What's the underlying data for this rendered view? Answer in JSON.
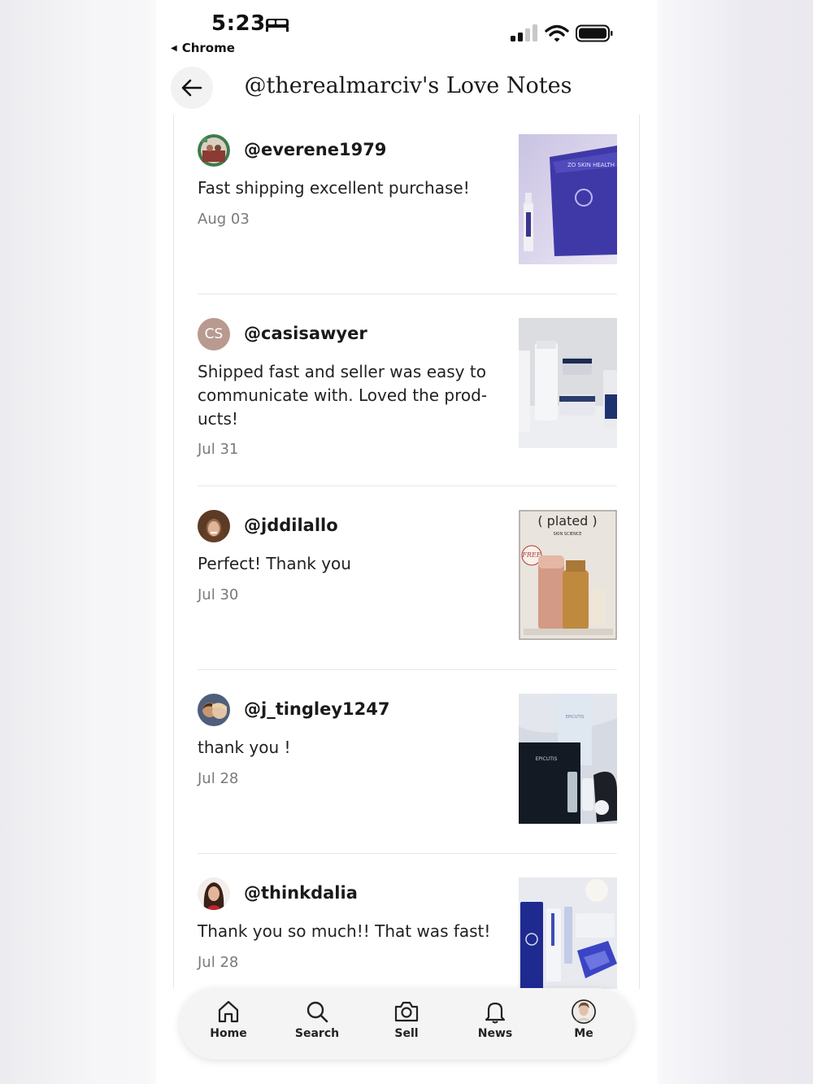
{
  "status_bar": {
    "time": "5:23",
    "back_app": "Chrome"
  },
  "header": {
    "title": "@therealmarciv's Love Notes"
  },
  "notes": [
    {
      "username": "@everene1979",
      "message": "Fast shipping excellent purchase!",
      "date": "Aug 03",
      "avatar_initials": ""
    },
    {
      "username": "@casisawyer",
      "message": "Shipped fast and seller was easy to communicate with. Loved the prod-ucts!",
      "date": "Jul 31",
      "avatar_initials": "CS"
    },
    {
      "username": "@jddilallo",
      "message": "Perfect! Thank you",
      "date": "Jul 30",
      "avatar_initials": ""
    },
    {
      "username": "@j_tingley1247",
      "message": "thank you !",
      "date": "Jul 28",
      "avatar_initials": ""
    },
    {
      "username": "@thinkdalia",
      "message": "Thank you so much!! That was fast!",
      "date": "Jul 28",
      "avatar_initials": ""
    }
  ],
  "product_labels": {
    "zo": "ZO SKIN HEALTH",
    "plated": "( plated )",
    "plated_sub": "SKIN SCIENCE",
    "free": "FREE",
    "epicutis": "EPICUTIS"
  },
  "bottom_nav": [
    {
      "label": "Home",
      "icon": "home-icon"
    },
    {
      "label": "Search",
      "icon": "search-icon"
    },
    {
      "label": "Sell",
      "icon": "camera-icon"
    },
    {
      "label": "News",
      "icon": "bell-icon"
    },
    {
      "label": "Me",
      "icon": "profile-avatar"
    }
  ],
  "colors": {
    "accent_avatar_cs": "#b99a90",
    "divider": "#e8e8e8",
    "date_text": "#7a7a7a"
  }
}
